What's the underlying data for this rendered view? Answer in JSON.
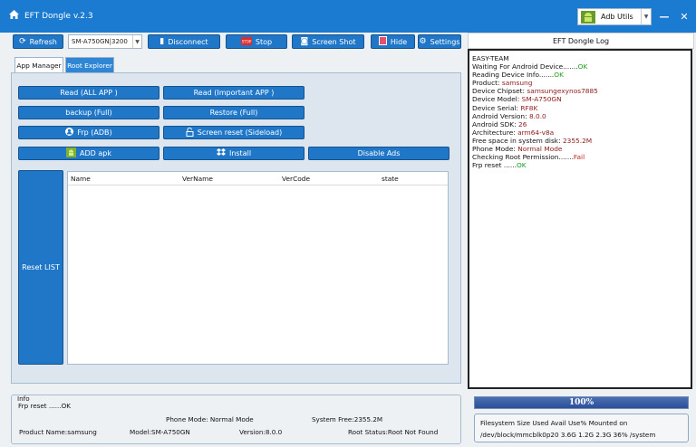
{
  "window": {
    "title": "EFT Dongle  v.2.3",
    "adb_label": "Adb Utils"
  },
  "toolbar": {
    "refresh": "Refresh",
    "model_value": "SM-A750GN|3200",
    "disconnect": "Disconnect",
    "stop": "Stop",
    "screenshot": "Screen Shot",
    "hide": "Hide",
    "settings": "Settings"
  },
  "tabs": {
    "app_manager": "App Manager",
    "root_explorer": "Root Explorer"
  },
  "actions": {
    "read_all": "Read (ALL APP )",
    "read_important": "Read (Important APP )",
    "backup": "backup (Full)",
    "restore": "Restore (Full)",
    "frp": "Frp (ADB)",
    "screen_reset": "Screen reset  (Sideload)",
    "add_apk": "ADD apk",
    "install": "Install",
    "disable_ads": "Disable Ads",
    "reset_list": "Reset LIST"
  },
  "table": {
    "columns": [
      "Name",
      "VerName",
      "VerCode",
      "state"
    ]
  },
  "log": {
    "title": "EFT Dongle Log",
    "team": "EASY-TEAM",
    "waiting": "Waiting For Android Device.......",
    "reading": "Reading Device Info.......",
    "ok": "OK",
    "fail": "Fail",
    "product_label": "Product: ",
    "product": "samsung",
    "chipset_label": "Device Chipset: ",
    "chipset": "samsungexynos7885",
    "model_label": "Device Model: ",
    "model": "SM-A750GN",
    "serial_label": "Device Serial: ",
    "serial": "RF8K",
    "version_label": "Android Version: ",
    "version": "8.0.0",
    "sdk_label": "Android SDK: ",
    "sdk": "26",
    "arch_label": "Architecture: ",
    "arch": "arm64-v8a",
    "space_label": "Free space in system disk: ",
    "space": "2355.2M",
    "mode_label": "Phone Mode: ",
    "mode": "Normal Mode",
    "root_label": "Checking Root Permission.......",
    "frp_label": "Frp reset ......"
  },
  "info": {
    "heading": "Info",
    "frp": "Frp reset ......OK",
    "phone_mode": "Phone Mode: Normal Mode",
    "system_free": "System Free:2355.2M",
    "product_name": "Product Name:samsung",
    "model": "Model:SM-A750GN",
    "version": "Version:8.0.0",
    "root_status": "Root Status:Root Not Found"
  },
  "progress": {
    "value": 100,
    "label": "100%"
  },
  "filesystem": {
    "header": "Filesystem        Size  Used Avail Use% Mounted on",
    "row": "/dev/block/mmcblk0p20 3.6G  1.2G  2.3G  36% /system"
  },
  "colors": {
    "accent": "#1a7bd0",
    "button": "#2077c8",
    "ok": "#1a9a1a",
    "value": "#8b1a1a"
  }
}
